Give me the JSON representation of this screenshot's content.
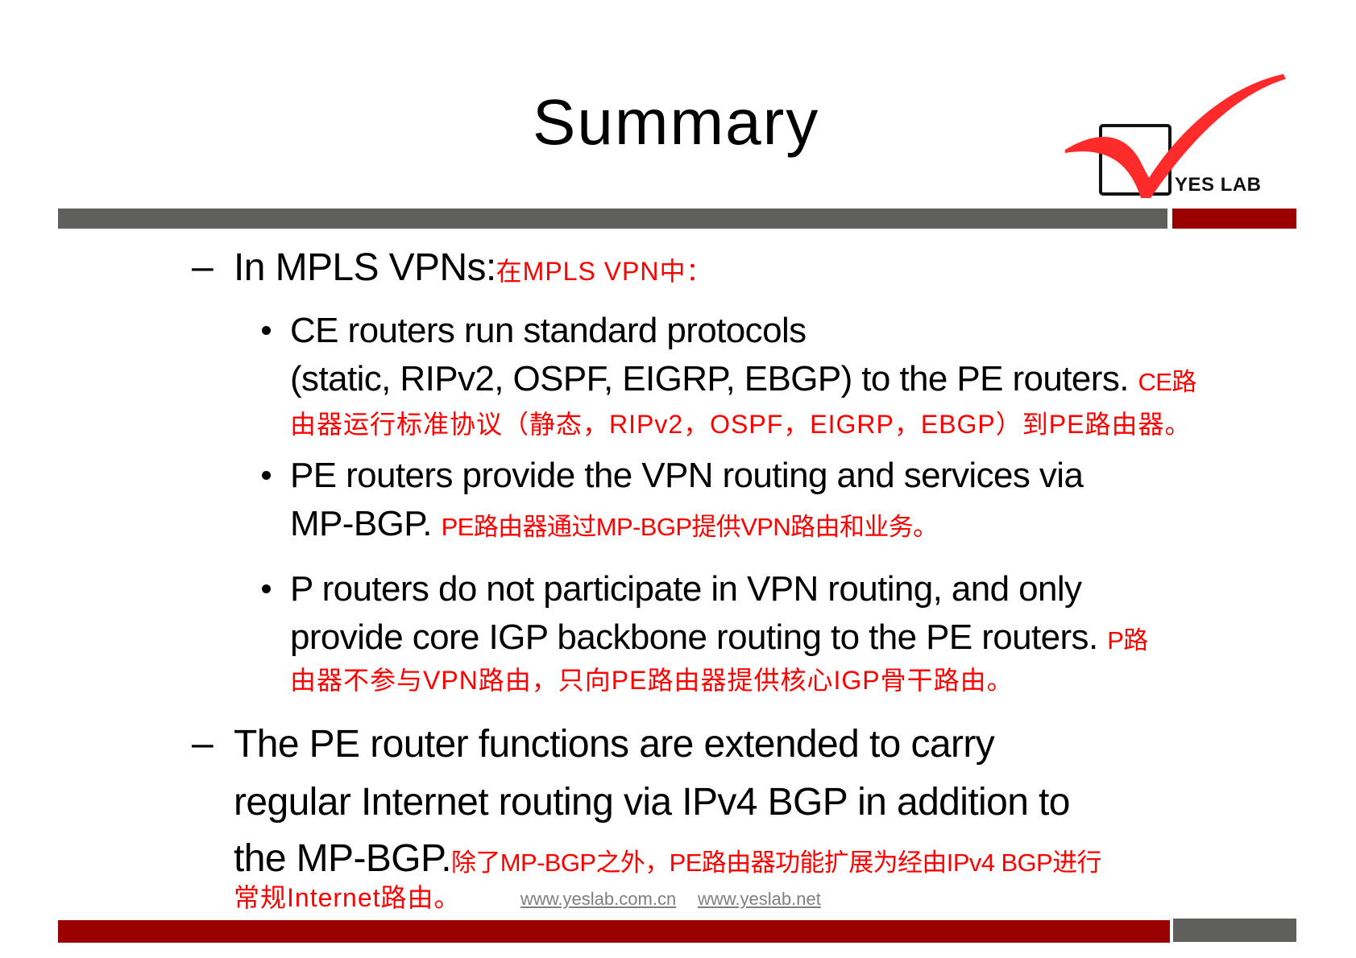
{
  "slide": {
    "title": "Summary",
    "logo": {
      "text": "YES LAB",
      "check_color": "#ff2a2a",
      "box_color": "#111111"
    },
    "colors": {
      "bar_gray": "#5f605e",
      "bar_red": "#9a0000",
      "translation_red": "#ff0000",
      "link_gray": "#7f7f7f"
    },
    "section1": {
      "dash": "–",
      "heading": "In MPLS VPNs:",
      "heading_cn": "在MPLS VPN中：",
      "bullets": [
        {
          "lines": [
            "CE routers run standard protocols",
            "(static, RIPv2, OSPF, EIGRP, EBGP) to the PE routers."
          ],
          "cn_inline": "CE路",
          "cn_line": "由器运行标准协议（静态，RIPv2，OSPF，EIGRP，EBGP）到PE路由器。"
        },
        {
          "lines": [
            "PE routers provide the VPN routing and services via",
            "MP-BGP."
          ],
          "cn_inline": "PE路由器通过MP-BGP提供VPN路由和业务。"
        },
        {
          "lines": [
            "P routers do not participate in VPN routing, and only",
            "provide core IGP backbone routing to the PE routers."
          ],
          "cn_inline": "P路",
          "cn_line": "由器不参与VPN路由，只向PE路由器提供核心IGP骨干路由。"
        }
      ]
    },
    "section2": {
      "dash": "–",
      "lines": [
        "The PE router functions are extended to carry",
        "regular Internet routing via IPv4 BGP in addition to",
        "the MP-BGP."
      ],
      "cn_inline": "除了MP-BGP之外，PE路由器功能扩展为经由IPv4  BGP进行",
      "cn_line": "常规Internet路由。"
    },
    "footer": {
      "links": [
        "www.yeslab.com.cn",
        "www.yeslab.net"
      ]
    }
  }
}
